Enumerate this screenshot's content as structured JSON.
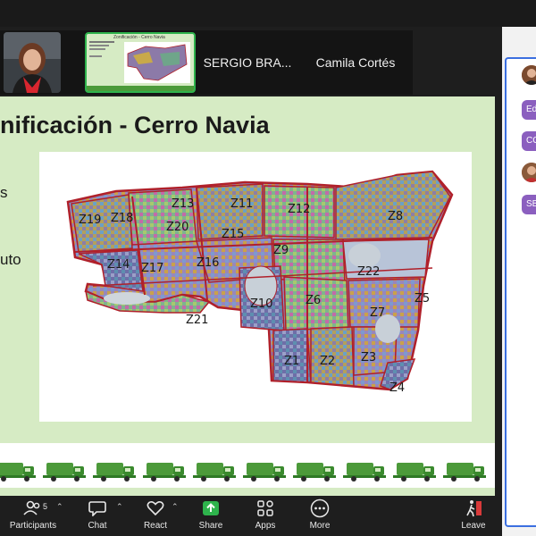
{
  "participants_strip": {
    "names": [
      "SERGIO BRA...",
      "Camila Cortés"
    ]
  },
  "slide": {
    "title": "nificación - Cerro Navia",
    "side_fragments": [
      "s",
      "uto"
    ],
    "map": {
      "zones": [
        "Z19",
        "Z18",
        "Z13",
        "Z11",
        "Z12",
        "Z8",
        "Z20",
        "Z15",
        "Z9",
        "Z14",
        "Z17",
        "Z16",
        "Z22",
        "Z5",
        "Z10",
        "Z6",
        "Z7",
        "Z21",
        "Z1",
        "Z2",
        "Z3",
        "Z4"
      ]
    }
  },
  "thumbnail": {
    "title": "Zonificación - Cerro Navia"
  },
  "right_panel": {
    "chips": [
      "Ed",
      "CC",
      "SB"
    ]
  },
  "toolbar": {
    "participants_label": "Participants",
    "participants_count": "5",
    "chat_label": "Chat",
    "react_label": "React",
    "share_label": "Share",
    "apps_label": "Apps",
    "more_label": "More",
    "leave_label": "Leave"
  },
  "colors": {
    "slide_bg": "#d6ebc4",
    "share_green": "#2eb34c",
    "zone_border": "#b0202a",
    "chip_purple": "#8b5fbf",
    "panel_blue": "#3b6fe0"
  }
}
